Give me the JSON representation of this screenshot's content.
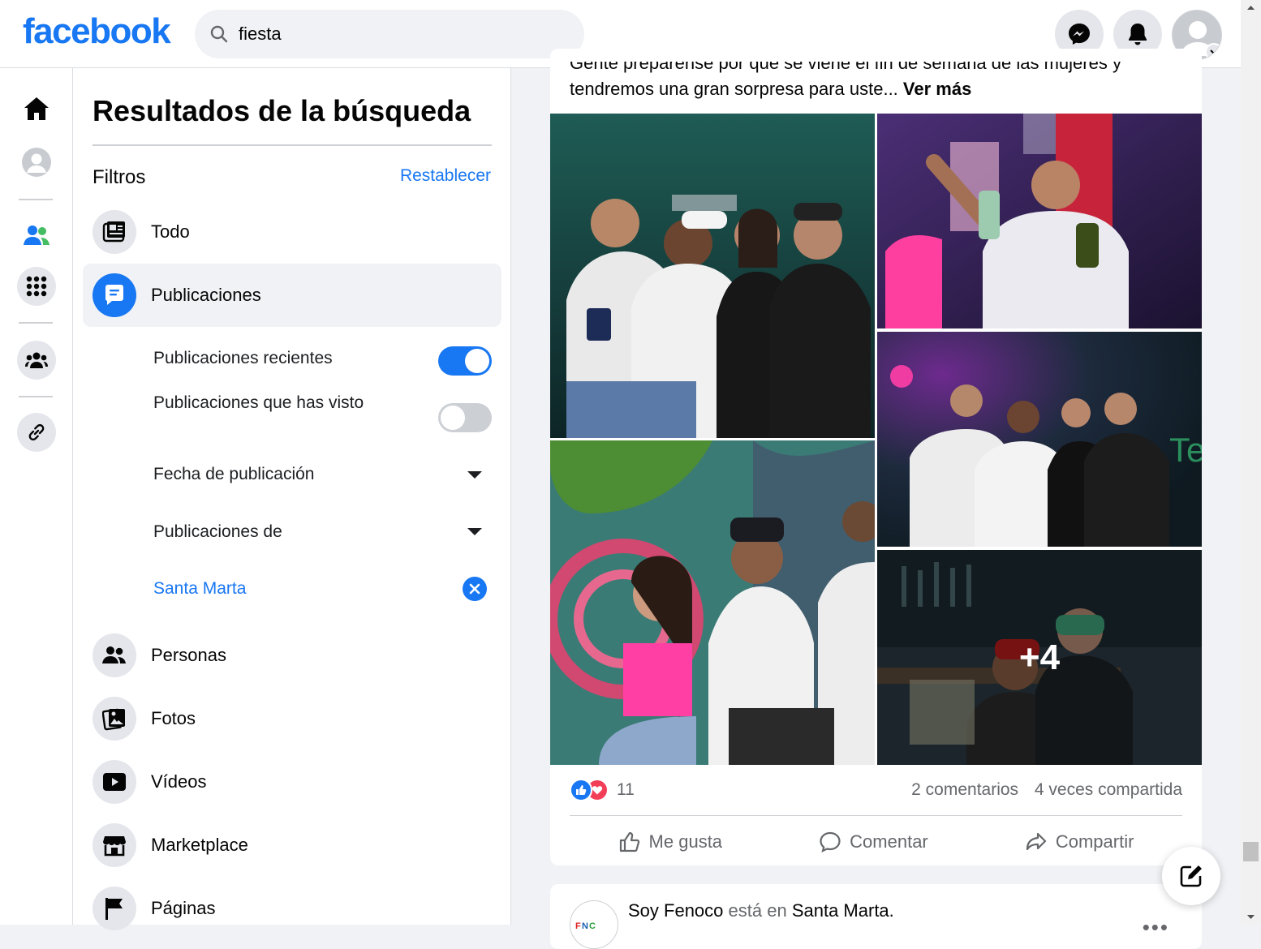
{
  "app": {
    "logo": "facebook",
    "brand_color": "#1877f2"
  },
  "search": {
    "value": "fiesta"
  },
  "header_icons": [
    "messenger-icon",
    "bell-icon",
    "account-avatar"
  ],
  "rail": {
    "items": [
      "home-icon",
      "profile-icon",
      "friends-icon",
      "apps-icon",
      "groups-icon",
      "link-icon"
    ]
  },
  "panel": {
    "title": "Resultados de la búsqueda",
    "filters_label": "Filtros",
    "reset_label": "Restablecer",
    "categories": [
      {
        "label": "Todo"
      },
      {
        "label": "Publicaciones"
      },
      {
        "label": "Personas"
      },
      {
        "label": "Fotos"
      },
      {
        "label": "Vídeos"
      },
      {
        "label": "Marketplace"
      },
      {
        "label": "Páginas"
      }
    ],
    "sub": {
      "recent": "Publicaciones recientes",
      "recent_on": true,
      "seen": "Publicaciones que has visto",
      "seen_on": false,
      "date": "Fecha de publicación",
      "from": "Publicaciones de",
      "location": "Santa Marta"
    }
  },
  "post": {
    "text_line1": "Gente prepárense por que se viene el fin de semana de las mujeres y",
    "text_line2": "tendremos una gran sorpresa para uste...",
    "see_more": "Ver más",
    "more_photos": "+4",
    "reactions_count": "11",
    "comments": "2 comentarios",
    "shares": "4 veces compartida",
    "like": "Me gusta",
    "comment": "Comentar",
    "share": "Compartir"
  },
  "post2": {
    "author": "Soy Fenoco",
    "is_at": "está en",
    "place": "Santa Marta",
    "period": "."
  }
}
